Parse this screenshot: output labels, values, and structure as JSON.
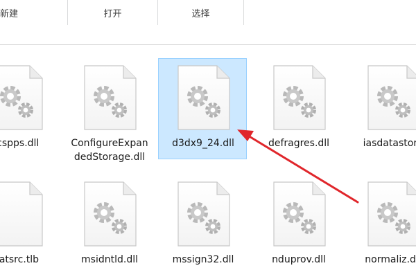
{
  "ribbon": {
    "groups": [
      {
        "label": "新建"
      },
      {
        "label": "打开"
      },
      {
        "label": "选择"
      }
    ]
  },
  "files": {
    "row1": [
      {
        "name": "rcspps.dll"
      },
      {
        "name_line1": "ConfigureExpan",
        "name_line2": "dedStorage.dll"
      },
      {
        "name": "d3dx9_24.dll",
        "selected": true
      },
      {
        "name": "defragres.dll"
      },
      {
        "name": "iasdatastore"
      }
    ],
    "row2": [
      {
        "name": "datsrc.tlb"
      },
      {
        "name": "msidntld.dll"
      },
      {
        "name": "mssign32.dll"
      },
      {
        "name": "nduprov.dll"
      },
      {
        "name": "normaliz.dll"
      }
    ]
  },
  "icon": "dll-settings-file-icon",
  "colors": {
    "selection_fill": "#cce8ff",
    "selection_border": "#99d1ff",
    "arrow": "#e0262b"
  }
}
